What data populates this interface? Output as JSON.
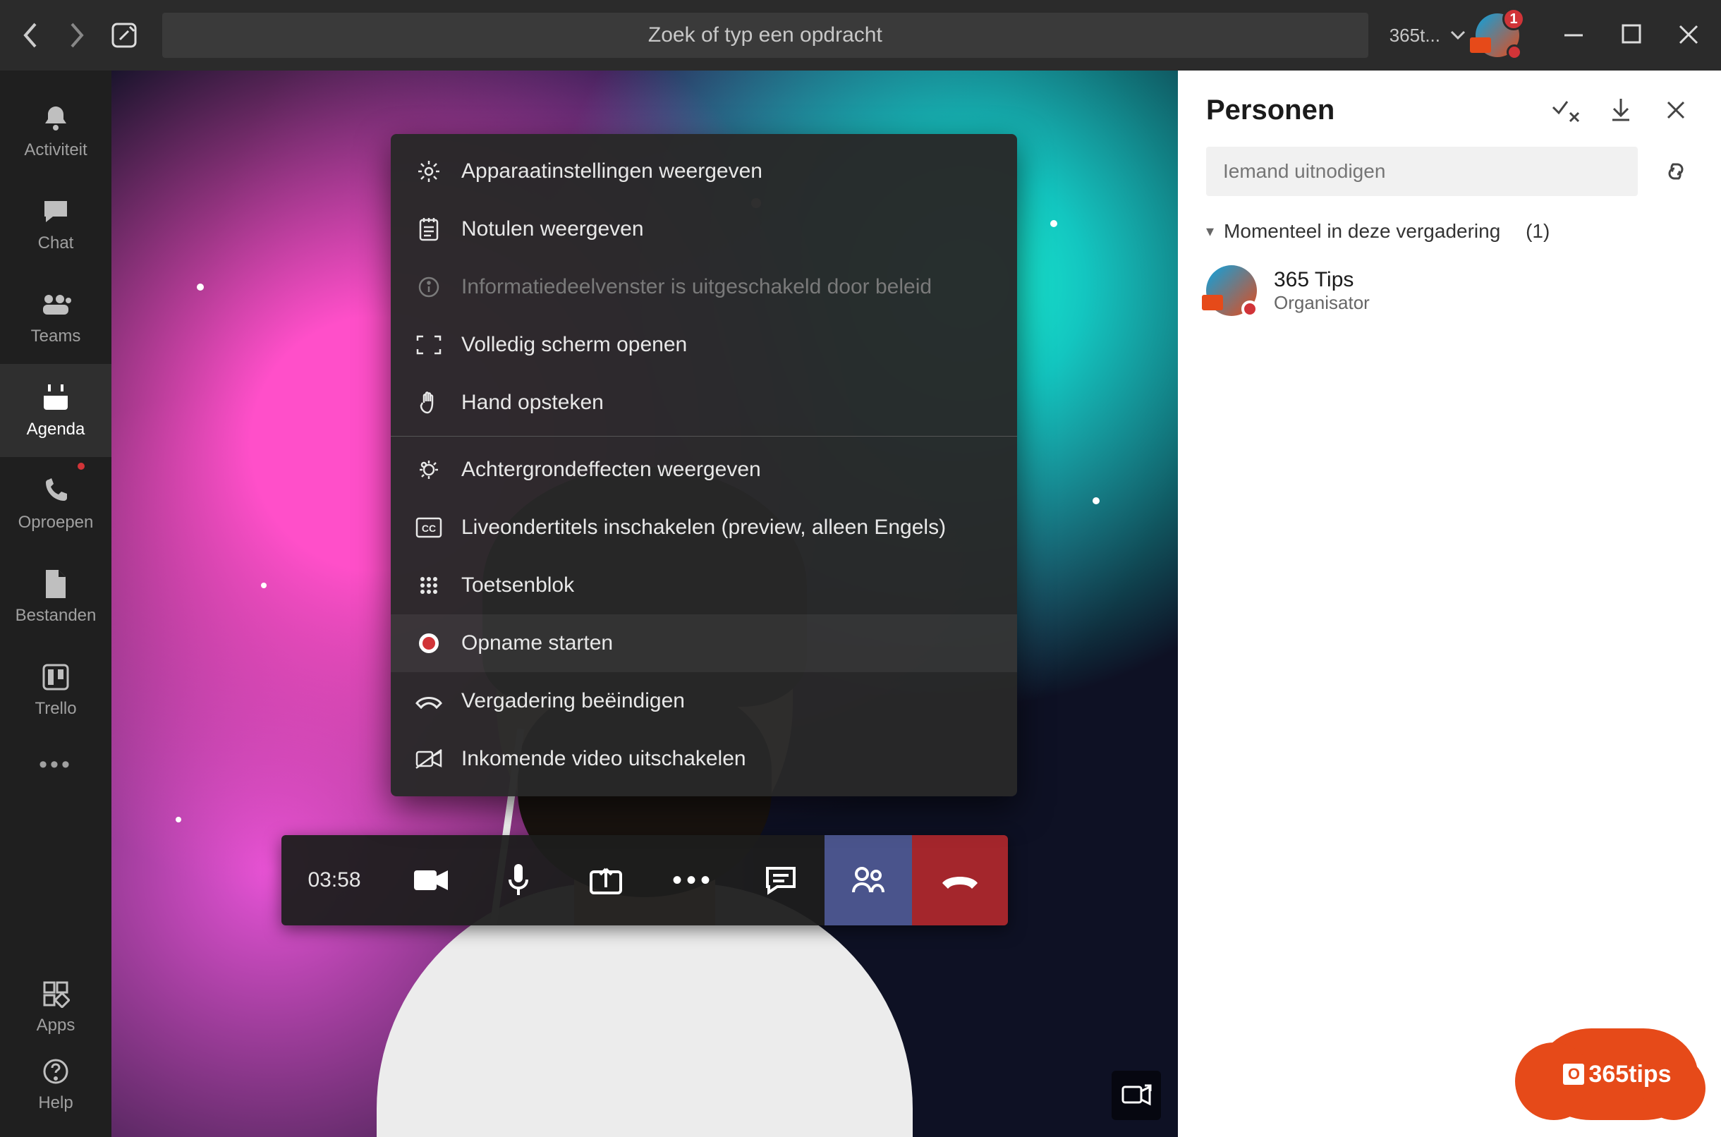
{
  "header": {
    "search_placeholder": "Zoek of typ een opdracht",
    "account_label": "365t...",
    "notification_count": "1"
  },
  "rail": {
    "items": [
      {
        "label": "Activiteit"
      },
      {
        "label": "Chat"
      },
      {
        "label": "Teams"
      },
      {
        "label": "Agenda"
      },
      {
        "label": "Oproepen"
      },
      {
        "label": "Bestanden"
      },
      {
        "label": "Trello"
      }
    ],
    "apps_label": "Apps",
    "help_label": "Help"
  },
  "controls": {
    "timer": "03:58"
  },
  "menu": {
    "device_settings": "Apparaatinstellingen weergeven",
    "meeting_notes": "Notulen weergeven",
    "info_disabled": "Informatiedeelvenster is uitgeschakeld door beleid",
    "fullscreen": "Volledig scherm openen",
    "raise_hand": "Hand opsteken",
    "bg_effects": "Achtergrondeffecten weergeven",
    "live_captions": "Liveondertitels inschakelen (preview, alleen Engels)",
    "keypad": "Toetsenblok",
    "start_recording": "Opname starten",
    "end_meeting": "Vergadering beëindigen",
    "disable_incoming_video": "Inkomende video uitschakelen"
  },
  "panel": {
    "title": "Personen",
    "invite_placeholder": "Iemand uitnodigen",
    "section_current": "Momenteel in deze vergadering",
    "section_count": "(1)",
    "attendee_name": "365 Tips",
    "attendee_role": "Organisator"
  },
  "brand": "365tips"
}
